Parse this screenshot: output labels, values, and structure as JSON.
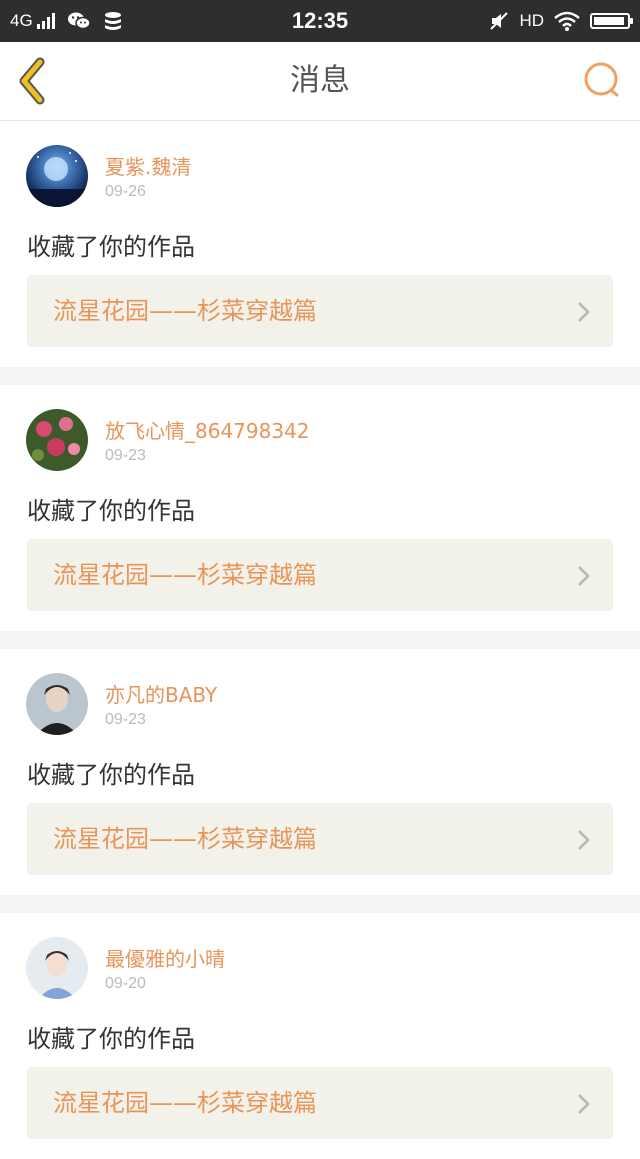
{
  "status_bar": {
    "network": "4G",
    "time": "12:35",
    "hd": "HD",
    "icons": [
      "signal-icon",
      "wechat-icon",
      "storage-icon",
      "mute-icon",
      "wifi-icon",
      "battery-icon"
    ]
  },
  "header": {
    "title": "消息",
    "back_icon": "back-chevron-icon",
    "search_icon": "search-icon",
    "accent_color": "#e8945a"
  },
  "messages": [
    {
      "user": "夏紫.魏清",
      "date": "09-26",
      "action": "收藏了你的作品",
      "work": "流星花园——杉菜穿越篇"
    },
    {
      "user": "放飞心情_864798342",
      "date": "09-23",
      "action": "收藏了你的作品",
      "work": "流星花园——杉菜穿越篇"
    },
    {
      "user": "亦凡的BABY",
      "date": "09-23",
      "action": "收藏了你的作品",
      "work": "流星花园——杉菜穿越篇"
    },
    {
      "user": "最優雅的小晴",
      "date": "09-20",
      "action": "收藏了你的作品",
      "work": "流星花园——杉菜穿越篇"
    }
  ]
}
